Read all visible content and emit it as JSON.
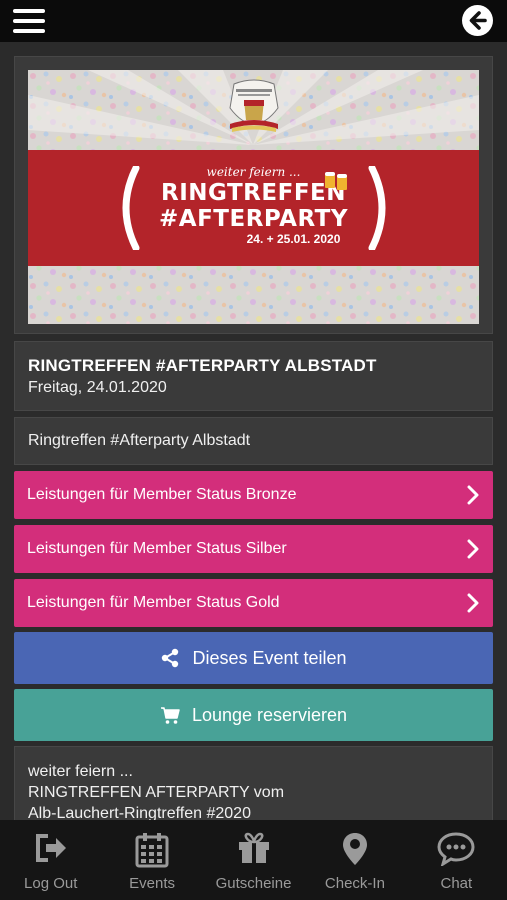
{
  "banner": {
    "script_line": "weiter feiern ...",
    "headline_1": "RINGTREFFEN",
    "headline_2": "#AFTERPARTY",
    "dates": "24. + 25.01. 2020",
    "colors": {
      "band": "#b3242a"
    }
  },
  "event": {
    "title": "RINGTREFFEN #AFTERPARTY ALBSTADT",
    "date": "Freitag, 24.01.2020",
    "subtitle": "Ringtreffen #Afterparty Albstadt"
  },
  "member_links": [
    {
      "label": "Leistungen für Member Status Bronze",
      "icon": "chevron-right-icon"
    },
    {
      "label": "Leistungen für Member Status Silber",
      "icon": "chevron-right-icon"
    },
    {
      "label": "Leistungen für Member Status Gold",
      "icon": "chevron-right-icon"
    }
  ],
  "actions": {
    "share": {
      "label": "Dieses Event teilen",
      "icon": "share-icon",
      "color": "#4a66b4"
    },
    "lounge": {
      "label": "Lounge reservieren",
      "icon": "cart-icon",
      "color": "#48a297"
    }
  },
  "description": {
    "line1": "weiter feiern ...",
    "line2": "RINGTREFFEN AFTERPARTY vom",
    "line3": "Alb-Lauchert-Ringtreffen #2020"
  },
  "tabs": [
    {
      "label": "Log Out",
      "icon": "logout-icon"
    },
    {
      "label": "Events",
      "icon": "calendar-icon"
    },
    {
      "label": "Gutscheine",
      "icon": "gift-icon"
    },
    {
      "label": "Check-In",
      "icon": "map-pin-icon"
    },
    {
      "label": "Chat",
      "icon": "chat-icon"
    }
  ],
  "colors": {
    "pink": "#d32e7b",
    "background": "#2b2b2b",
    "card": "#3a3a3a"
  }
}
